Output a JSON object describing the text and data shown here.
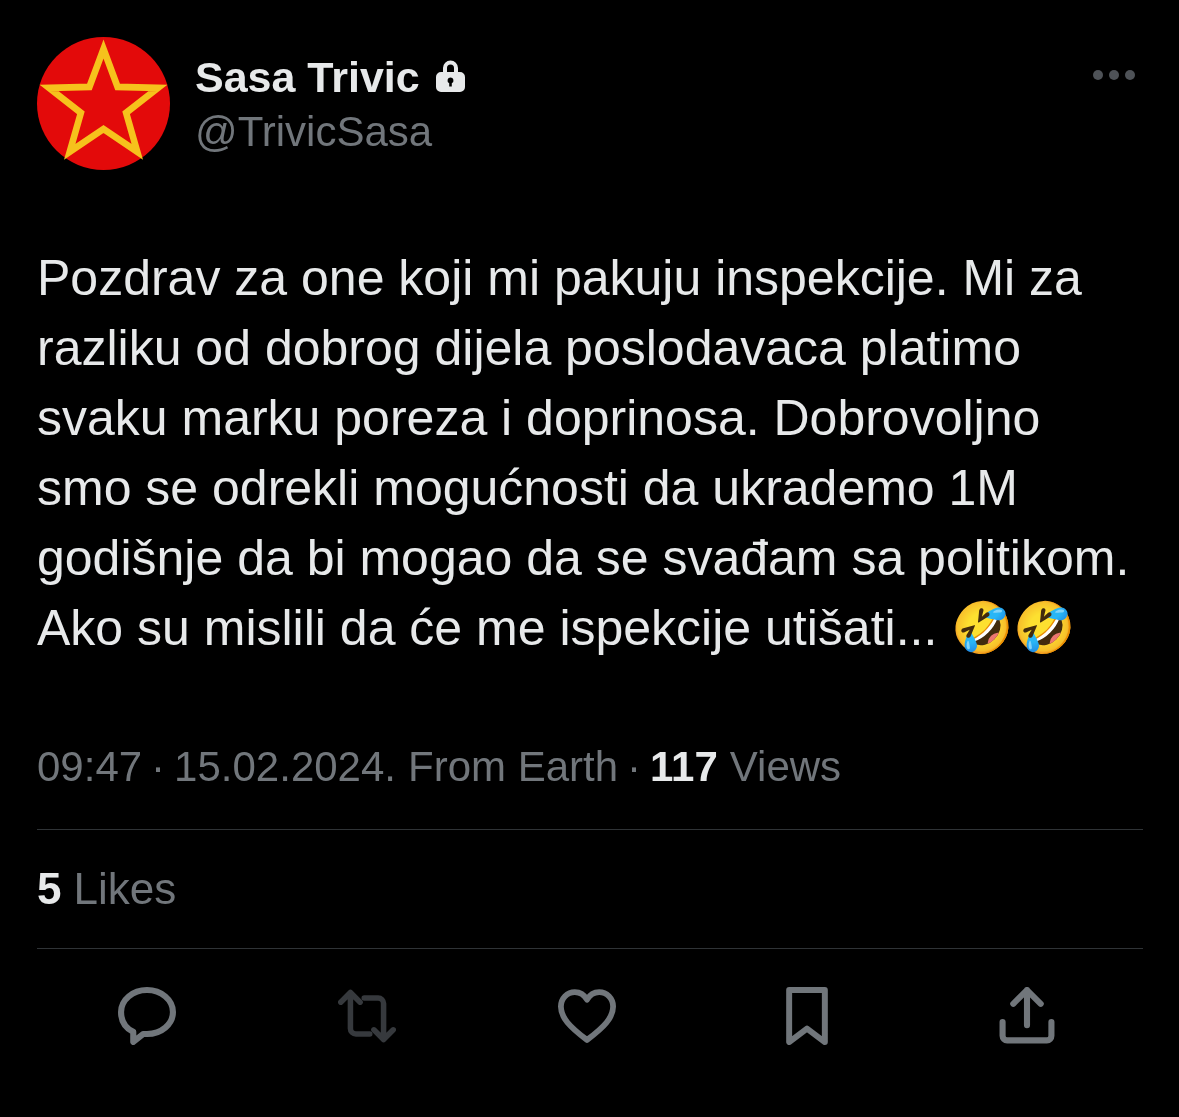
{
  "author": {
    "name": "Sasa Trivic",
    "protected": true,
    "handle": "@TrivicSasa"
  },
  "tweet": {
    "text": "Pozdrav za one koji mi pakuju inspekcije. Mi za razliku od dobrog dijela poslodavaca platimo svaku marku poreza i doprinosa. Dobrovoljno smo se odrekli mogućnosti da ukrademo 1M godišnje da bi mogao da se svađam sa politikom. Ako su mislili da će me ispekcije utišati... 🤣🤣"
  },
  "meta": {
    "time": "09:47",
    "separator_1": "·",
    "date": "15.02.2024.",
    "source": "From Earth",
    "separator_2": "·",
    "views_count": "117",
    "views_label": "Views"
  },
  "likes": {
    "count": "5",
    "label": "Likes"
  },
  "actions": [
    {
      "kind": "reply",
      "disabled": false
    },
    {
      "kind": "repost",
      "disabled": true
    },
    {
      "kind": "like",
      "disabled": false
    },
    {
      "kind": "bookmark",
      "disabled": false
    },
    {
      "kind": "share",
      "disabled": false
    }
  ]
}
